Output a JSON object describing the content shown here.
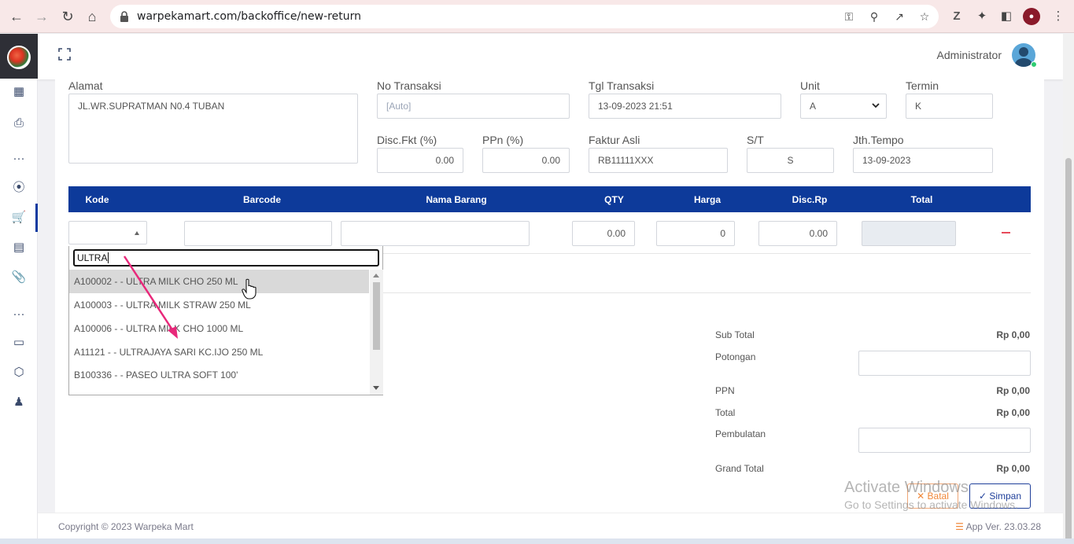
{
  "browser": {
    "url": "warpekamart.com/backoffice/new-return"
  },
  "header": {
    "user_name": "Administrator"
  },
  "form": {
    "alamat_label": "Alamat",
    "alamat_value": "JL.WR.SUPRATMAN N0.4 TUBAN",
    "no_transaksi_label": "No Transaksi",
    "no_transaksi_placeholder": "[Auto]",
    "tgl_transaksi_label": "Tgl Transaksi",
    "tgl_transaksi_value": "13-09-2023 21:51",
    "unit_label": "Unit",
    "unit_value": "A",
    "termin_label": "Termin",
    "termin_value": "K",
    "disc_fkt_label": "Disc.Fkt (%)",
    "disc_fkt_value": "0.00",
    "ppn_label": "PPn (%)",
    "ppn_value": "0.00",
    "faktur_asli_label": "Faktur Asli",
    "faktur_asli_value": "RB11111XXX",
    "st_label": "S/T",
    "st_value": "S",
    "jth_tempo_label": "Jth.Tempo",
    "jth_tempo_value": "13-09-2023"
  },
  "table": {
    "columns": [
      "Kode",
      "Barcode",
      "Nama Barang",
      "QTY",
      "Harga",
      "Disc.Rp",
      "Total"
    ],
    "row": {
      "qty": "0.00",
      "harga": "0",
      "disc": "0.00"
    }
  },
  "dropdown": {
    "search": "ULTRA",
    "items": [
      "A100002 - - ULTRA MILK CHO 250 ML",
      "A100003 - - ULTRA MILK STRAW 250 ML",
      "A100006 - - ULTRA MILK CHO 1000 ML",
      "A11121 - - ULTRAJAYA SARI KC.IJO 250 ML",
      "B100336 - - PASEO ULTRA SOFT 100'"
    ]
  },
  "summary": {
    "sub_total_label": "Sub Total",
    "sub_total_value": "Rp 0,00",
    "potongan_label": "Potongan",
    "ppn_label": "PPN",
    "ppn_value": "Rp 0,00",
    "total_label": "Total",
    "total_value": "Rp 0,00",
    "pembulatan_label": "Pembulatan",
    "grand_total_label": "Grand Total",
    "grand_total_value": "Rp 0,00"
  },
  "actions": {
    "batal_label": "Batal",
    "simpan_label": "Simpan"
  },
  "watermark": {
    "line1": "Activate Windows",
    "line2": "Go to Settings to activate Windows."
  },
  "footer": {
    "copyright": "Copyright © 2023 Warpeka Mart",
    "version": "App Ver. 23.03.28"
  },
  "colors": {
    "primary": "#0d3a9a",
    "danger": "#e74a5a",
    "warning": "#f0883a",
    "annotation": "#e8287a"
  }
}
